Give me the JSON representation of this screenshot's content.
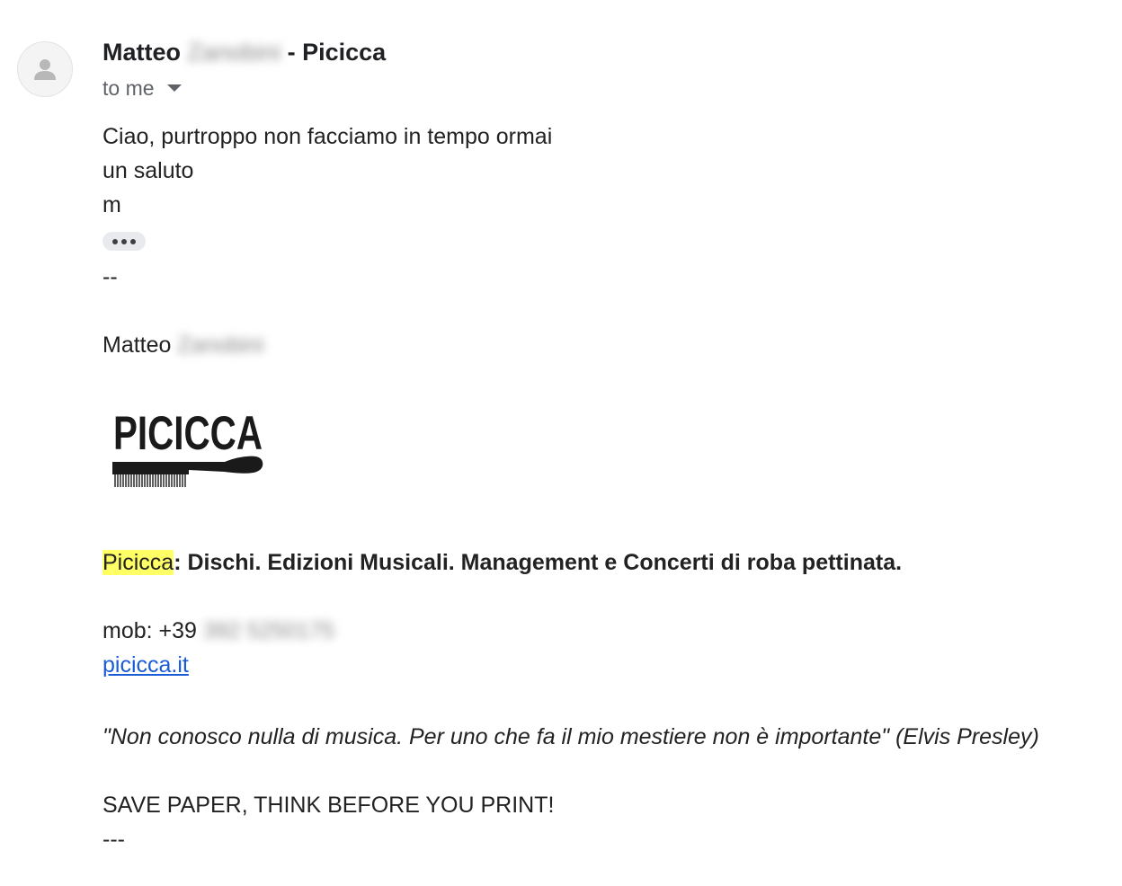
{
  "header": {
    "sender_first": "Matteo",
    "sender_last_redacted": "Zanobini",
    "sender_suffix": "- Picicca",
    "recipient_label": "to me",
    "avatar_icon": "person-icon"
  },
  "message": {
    "line1": "Ciao, purtroppo non facciamo in tempo ormai",
    "line2": "un saluto",
    "line3": "m",
    "expand_icon": "ellipsis-icon"
  },
  "signature": {
    "separator": "--",
    "name_first": "Matteo",
    "name_last_redacted": "Zanobini",
    "logo_text": "PICICCA",
    "brand": "Picicca",
    "tagline": ": Dischi. Edizioni Musicali. Management e Concerti di roba pettinata.",
    "mobile_label": "mob: +",
    "mobile_prefix": "39",
    "mobile_redacted": "392 5250175",
    "website": "picicca.it",
    "quote": "\"Non conosco nulla di musica. Per uno che fa il mio mestiere non è importante\" (Elvis Presley)",
    "save_paper": "SAVE PAPER, THINK BEFORE YOU PRINT!",
    "end_separator": "---"
  },
  "colors": {
    "highlight": "#ffff66",
    "link": "#1a5bd6",
    "ellipsis_bg": "#e8eaed"
  }
}
